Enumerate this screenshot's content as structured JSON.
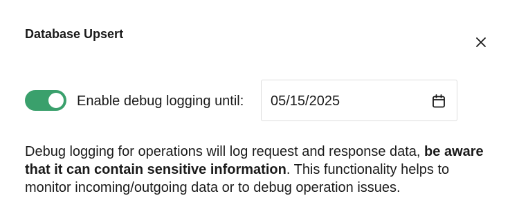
{
  "dialog": {
    "title": "Database Upsert",
    "close_icon": "close-icon"
  },
  "debug": {
    "toggle_on": true,
    "toggle_color": "#3aa06c",
    "label": "Enable debug logging until:",
    "date_value": "05/15/2025",
    "calendar_icon": "calendar-icon"
  },
  "description": {
    "part1": "Debug logging for operations will log request and response data, ",
    "bold": "be aware that it can contain sensitive information",
    "part2": ". This functionality helps to monitor incoming/outgoing data or to debug operation issues."
  }
}
